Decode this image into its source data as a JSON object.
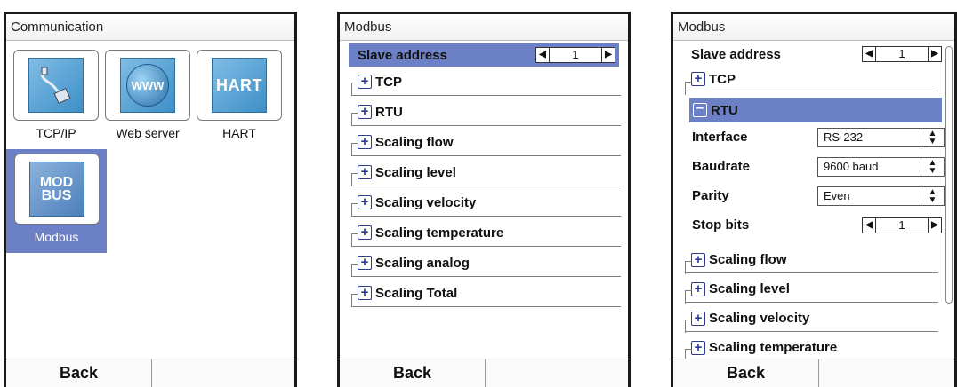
{
  "screens": [
    {
      "title": "Communication",
      "tiles": [
        {
          "icon": "tcpip-icon",
          "label": "TCP/IP"
        },
        {
          "icon": "web-server-icon",
          "label": "Web server",
          "glyph": "WWW"
        },
        {
          "icon": "hart-icon",
          "label": "HART",
          "glyph": "HART"
        },
        {
          "icon": "modbus-icon",
          "label": "Modbus",
          "glyph1": "MOD",
          "glyph2": "BUS"
        }
      ],
      "back": "Back"
    },
    {
      "title": "Modbus",
      "slave_label": "Slave address",
      "slave_value": "1",
      "groups": [
        "TCP",
        "RTU",
        "Scaling flow",
        "Scaling level",
        "Scaling velocity",
        "Scaling temperature",
        "Scaling analog",
        "Scaling Total"
      ],
      "back": "Back"
    },
    {
      "title": "Modbus",
      "slave_label": "Slave address",
      "slave_value": "1",
      "tcp": "TCP",
      "rtu": "RTU",
      "fields": {
        "interface": {
          "label": "Interface",
          "value": "RS-232"
        },
        "baudrate": {
          "label": "Baudrate",
          "value": "9600 baud"
        },
        "parity": {
          "label": "Parity",
          "value": "Even"
        },
        "stopbits": {
          "label": "Stop bits",
          "value": "1"
        }
      },
      "groups": [
        "Scaling flow",
        "Scaling level",
        "Scaling velocity",
        "Scaling temperature"
      ],
      "back": "Back"
    }
  ],
  "glyphs": {
    "left": "◀",
    "right": "▶",
    "plus": "+",
    "minus": "−",
    "up": "▲",
    "down": "▼"
  },
  "colors": {
    "selection": "#6b80c5",
    "tile_blue": "#3e8fc7"
  }
}
